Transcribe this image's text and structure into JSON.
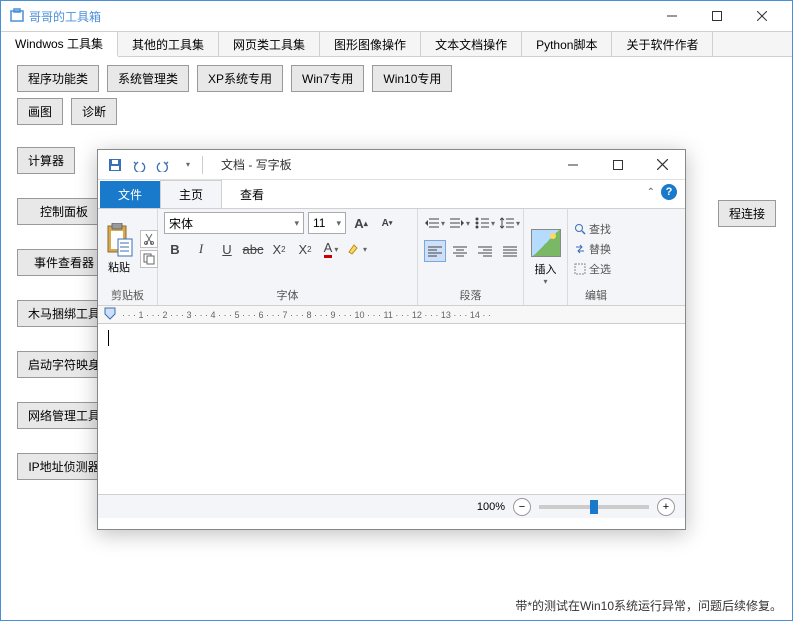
{
  "parent": {
    "title": "哥哥的工具箱",
    "menu": [
      "Windwos 工具集",
      "其他的工具集",
      "网页类工具集",
      "图形图像操作",
      "文本文档操作",
      "Python脚本",
      "关于软件作者"
    ],
    "row1": [
      "程序功能类",
      "系统管理类",
      "XP系统专用",
      "Win7专用",
      "Win10专用"
    ],
    "row2": [
      "画图",
      "诊断"
    ],
    "row3": [
      "计算器"
    ],
    "side": [
      "控制面板",
      "事件查看器",
      "木马捆绑工具",
      "启动字符映身",
      "网络管理工具",
      "IP地址侦测器"
    ],
    "right": "程连接",
    "footer": "带*的测试在Win10系统运行异常，问题后续修复。"
  },
  "wordpad": {
    "title": "文档 - 写字板",
    "tabs": {
      "file": "文件",
      "home": "主页",
      "view": "查看"
    },
    "clipboard": {
      "paste": "粘贴",
      "label": "剪贴板"
    },
    "font": {
      "name": "宋体",
      "size": "11",
      "label": "字体"
    },
    "para": {
      "label": "段落"
    },
    "insert": {
      "btn": "插入",
      "label": ""
    },
    "edit": {
      "find": "查找",
      "replace": "替换",
      "select": "全选",
      "label": "编辑"
    },
    "zoom": "100%"
  }
}
